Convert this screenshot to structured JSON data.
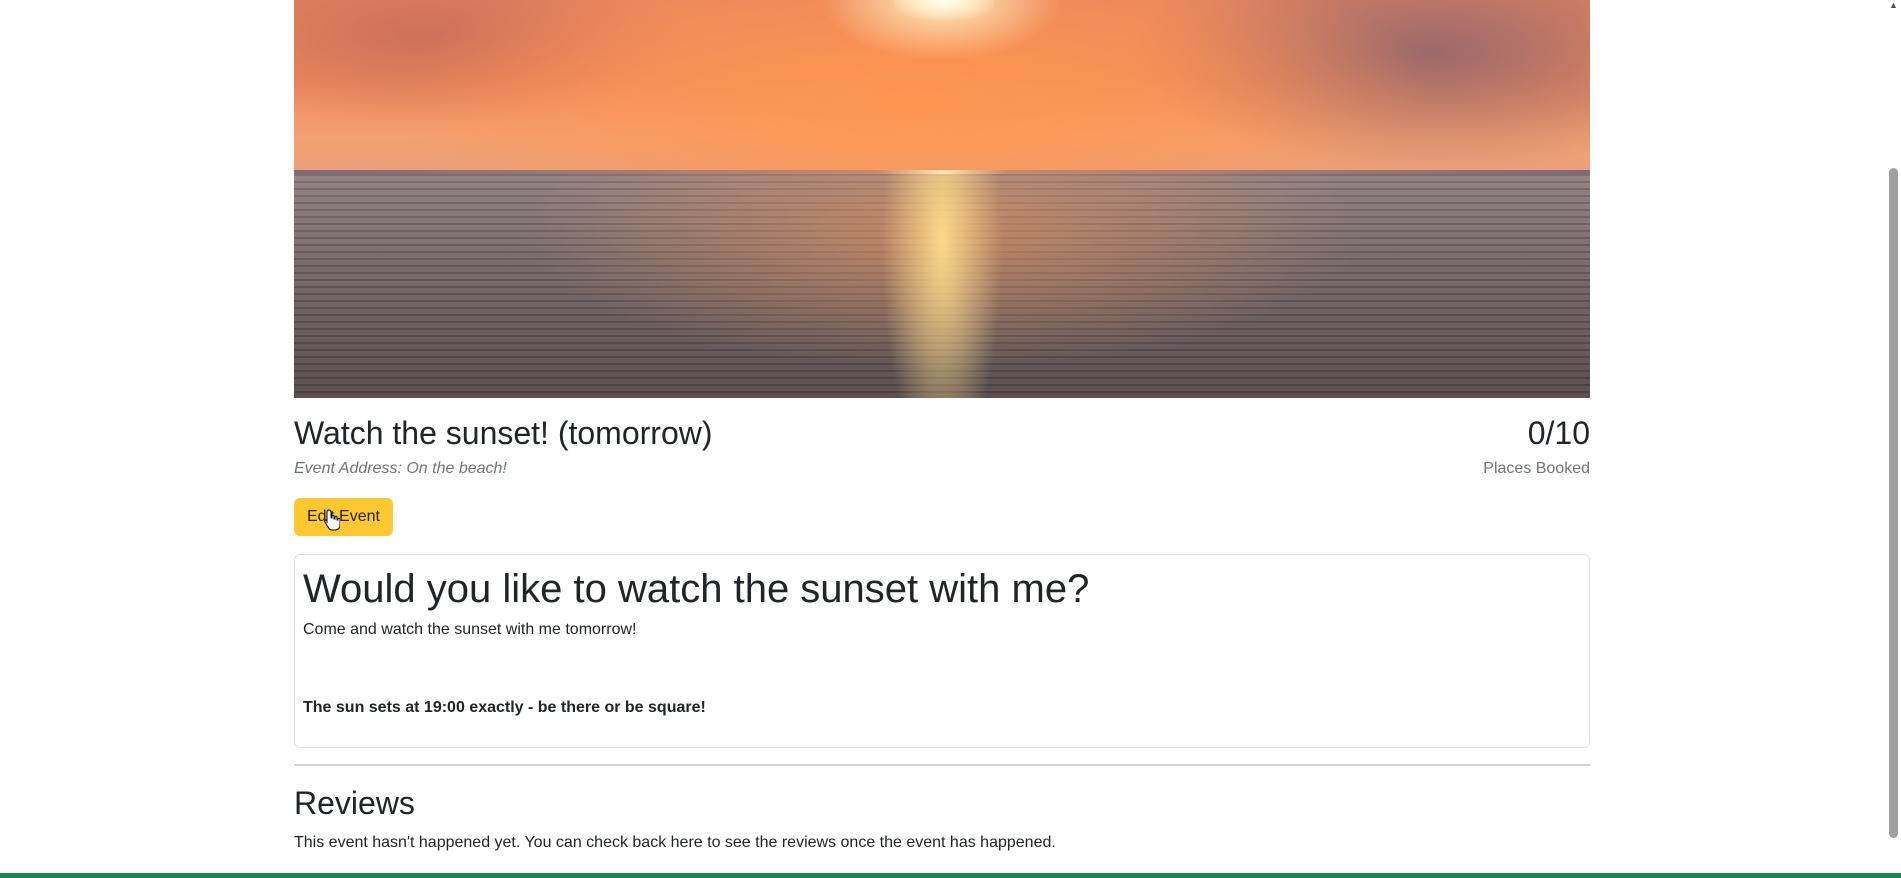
{
  "event": {
    "title": "Watch the sunset! (tomorrow)",
    "address": "Event Address: On the beach!",
    "places_count": "0/10",
    "places_label": "Places Booked",
    "edit_button_label": "Edit Event"
  },
  "description": {
    "heading": "Would you like to watch the sunset with me?",
    "line": "Come and watch the sunset with me tomorrow!",
    "bold_line": "The sun sets at 19:00 exactly - be there or be square!"
  },
  "reviews": {
    "title": "Reviews",
    "text": "This event hasn't happened yet. You can check back here to see the reviews once the event has happened."
  },
  "colors": {
    "edit_button": "#ffc832",
    "bottom_bar": "#198754"
  },
  "icons": {
    "scroll_up": "chevron-up-icon",
    "cursor": "hand-pointer-icon"
  }
}
